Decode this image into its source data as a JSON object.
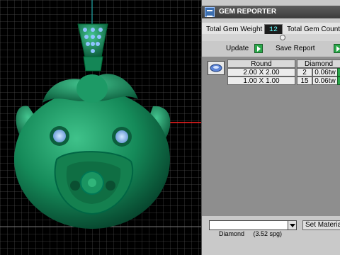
{
  "panel": {
    "title": "GEM REPORTER",
    "total_weight_label": "Total Gem Weight",
    "total_weight_value": "12",
    "total_count_label": "Total Gem Count",
    "update_label": "Update",
    "save_report_label": "Save Report"
  },
  "gem_table": {
    "shape_header": "Round",
    "material_header": "Diamond",
    "rows": [
      {
        "size": "2.00 X 2.00",
        "count": "2",
        "weight": "0.06tw"
      },
      {
        "size": "1.00 X 1.00",
        "count": "15",
        "weight": "0.06tw"
      }
    ]
  },
  "material_select": {
    "value": "Diamond     (3.52 spg)"
  },
  "set_material_label": "Set Materia",
  "icons": {
    "app": "gem-reporter-icon",
    "gem": "round-gem-icon"
  },
  "colors": {
    "model": "#1a8a5c",
    "grid": "#5a5a5a",
    "axis_red": "#ff2020",
    "accent_green": "#2aa84a"
  }
}
